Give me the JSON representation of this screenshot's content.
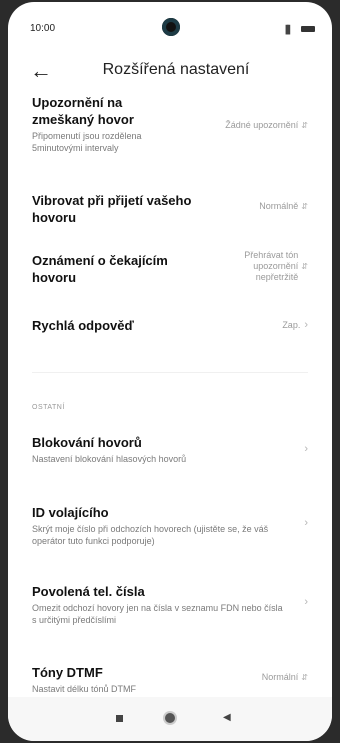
{
  "status": {
    "time": "10:00",
    "signal": "▐▌"
  },
  "header": {
    "back_glyph": "←",
    "title": "Rozšířená nastavení"
  },
  "settings_top": [
    {
      "title": "Upozornění na zmeškaný hovor",
      "subtitle": "Připomenutí jsou rozdělena 5minutovými intervaly",
      "value": "Žádné upozornění",
      "control": "updown"
    },
    {
      "title": "Vibrovat při přijetí vašeho hovoru",
      "subtitle": "",
      "value": "Normálně",
      "control": "updown"
    },
    {
      "title": "Oznámení o čekajícím hovoru",
      "subtitle": "",
      "value": "Přehrávat tón upozornění nepřetržitě",
      "control": "updown"
    },
    {
      "title": "Rychlá odpověď",
      "subtitle": "",
      "value": "Zap.",
      "control": "chevron"
    }
  ],
  "section_other": "OSTATNÍ",
  "settings_other": [
    {
      "title": "Blokování hovorů",
      "subtitle": "Nastavení blokování hlasových hovorů",
      "value": "",
      "control": "chevron"
    },
    {
      "title": "ID volajícího",
      "subtitle": "Skrýt moje číslo při odchozích hovorech (ujistěte se, že váš operátor tuto funkci podporuje)",
      "value": "",
      "control": "chevron"
    },
    {
      "title": "Povolená tel. čísla",
      "subtitle": "Omezit odchozí hovory jen na čísla v seznamu FDN nebo čísla s určitými předčíslími",
      "value": "",
      "control": "chevron"
    },
    {
      "title": "Tóny DTMF",
      "subtitle": "Nastavit délku tónů DTMF",
      "value": "Normální",
      "control": "updown"
    }
  ],
  "glyphs": {
    "updown": "⇵",
    "chevron": "›"
  },
  "nav": {
    "back_glyph": "◀"
  }
}
